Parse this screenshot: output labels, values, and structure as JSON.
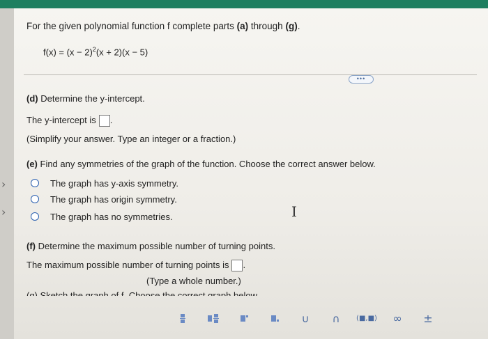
{
  "question": {
    "title_prefix": "For the given polynomial function f complete parts ",
    "title_a": "(a)",
    "title_mid": " through ",
    "title_g": "(g)",
    "title_end": ".",
    "func_part1": "f(x) = (x − 2)",
    "func_exp": "2",
    "func_part2": "(x + 2)(x − 5)"
  },
  "more_button": "•••",
  "part_d": {
    "label": "(d)",
    "heading": " Determine the y-intercept.",
    "prompt": "The y-intercept is",
    "suffix": ".",
    "hint": "(Simplify your answer. Type an integer or a fraction.)"
  },
  "part_e": {
    "label": "(e)",
    "heading": " Find any symmetries of the graph of the function. Choose the correct answer below.",
    "options": [
      "The graph has y-axis symmetry.",
      "The graph has origin symmetry.",
      "The graph has no symmetries."
    ]
  },
  "part_f": {
    "label": "(f)",
    "heading": " Determine the maximum possible number of turning points.",
    "prompt": "The maximum possible number of turning points is",
    "suffix": ".",
    "hint": "(Type a whole number.)"
  },
  "part_g_cut": "(g) Sketch the graph of f. Choose the correct graph below.",
  "toolbar": {
    "buttons": [
      "fraction-icon",
      "mixed-number-icon",
      "exponent-icon",
      "subscript-icon",
      "union-icon",
      "intersection-icon",
      "interval-icon",
      "infinity-icon",
      "plus-minus-icon"
    ],
    "interval_label": "(■,■)",
    "infinity_label": "∞",
    "plusminus_label": "±",
    "union_label": "∪",
    "intersection_label": "∩"
  }
}
